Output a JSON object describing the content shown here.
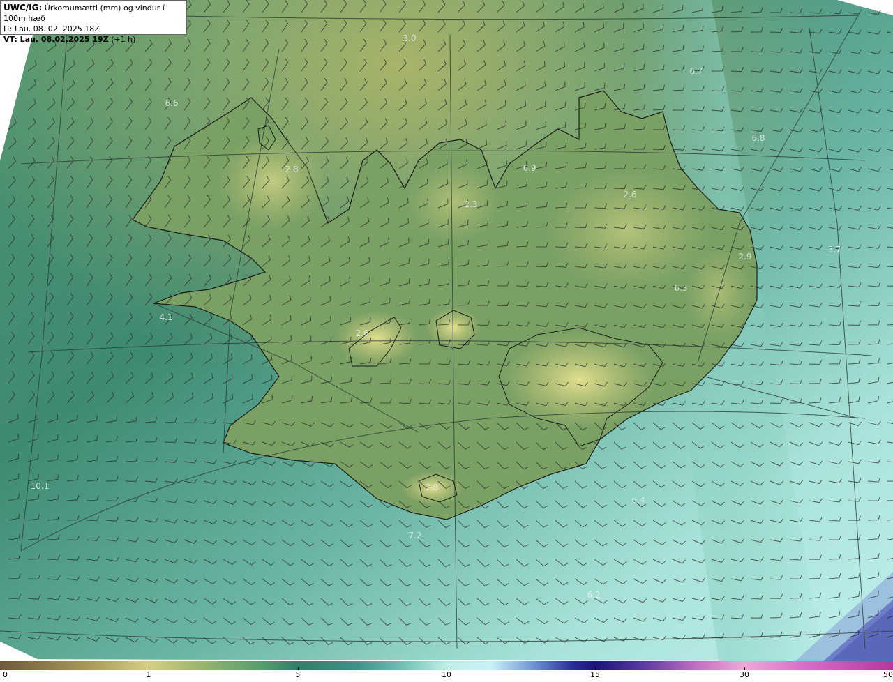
{
  "header": {
    "model": "UWC/IG:",
    "title": "Úrkomumætti (mm) og vindur í 100m hæð",
    "init_time": "IT: Lau. 08. 02. 2025 18Z",
    "valid_prefix": "VT: Lau. 08.02.2025 19Z",
    "valid_suffix": " (+1 h)"
  },
  "map_labels": [
    "3.0",
    "6.7",
    "6.6",
    "6.8",
    "2.8",
    "6.9",
    "2.6",
    "2.3",
    "3.7",
    "2.9",
    "6.3",
    "4.1",
    "2.6",
    "10.1",
    "2.8",
    "6.4",
    "7.2",
    "6.2"
  ],
  "colorbar": {
    "ticks": [
      "0",
      "1",
      "5",
      "10",
      "15",
      "30",
      "50"
    ]
  },
  "colors": {
    "land_yellow": "#c9c97a",
    "land_green": "#6b9a66",
    "sea_green": "#3c8a6e",
    "sea_light": "#9fdcd4",
    "sea_deep": "#3c3fa8",
    "coastline": "#1a1a1a",
    "barb": "#2b2b2b"
  }
}
